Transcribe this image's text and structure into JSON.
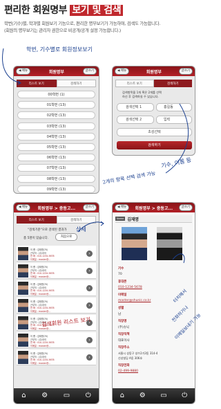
{
  "header": {
    "title_plain": "편리한 회원명부 ",
    "title_highlight": "보기 및 검색",
    "desc_line1": "학번(기수)별, 학과별 회원보기 기능으로, 편리한 명부보기가 가능하며, 검색도 가능합니다.",
    "desc_line2": "(회원의 명부보기는 관리자 권한으로 비공개/공개 설정 가능합니다.)"
  },
  "notes": {
    "n1": "학번, 기수별로 회원정보보기",
    "n2a": "기수, 이름 등",
    "n2b": "2개의 항목 선택 검색 가능",
    "n3": "상세",
    "n4": "검색회원 리스트 보기",
    "n5a": "전화하거나",
    "n5b": "이메일보내기 가능",
    "n5c": "터치해서"
  },
  "phone1": {
    "back": "◀ 메뉴",
    "title": "회원명부",
    "write": "글쓰기",
    "tab_list": "리스트 보기",
    "tab_search": "검색하기",
    "rows": [
      "00학번 (1)",
      "01학번 (13)",
      "02학번 (13)",
      "03학번 (13)",
      "04학번 (13)",
      "05학번 (13)",
      "06학번 (13)",
      "07학번 (13)",
      "08학번 (13)",
      "09학번 (13)"
    ]
  },
  "phone2": {
    "back": "◀ 메뉴",
    "title": "회원명부",
    "write": "글쓰기",
    "tab_list": "리스트 보기",
    "tab_search": "검색하기",
    "info1": "검색항목을 1개 혹은 2개를 선택",
    "info2": "하신 후 검색하실 수 있습니다.",
    "sel1": "검색선택 1",
    "sel1_val": "홍길동",
    "sel2": "검색선택 2",
    "sel2_val": "입력",
    "sel3": "초성선택",
    "search_btn": "검색하기"
  },
  "phone3": {
    "back": "◀ 메뉴",
    "title": "회원명부 > 중동고...",
    "write": "글쓰기",
    "tab_list": "리스트 보기",
    "tab_search": "검색하기",
    "result_text": "\"검색기준\"으로 검색된 결과가",
    "count_text": "총 5명이 있습니다.",
    "first_btn": "처음으로",
    "persons": [
      {
        "name": "이   름 : 김재명(70)",
        "job": "근무처 : (주)아이",
        "tel": "전   화 : 010-1234-5678",
        "mail": "이메일 : master@..."
      },
      {
        "name": "이   름 : 김재명(70)",
        "job": "근무처 : (주)아이",
        "tel": "전   화 : 010-1234-5678",
        "mail": "이메일 : master@..."
      },
      {
        "name": "이   름 : 김재명(70)",
        "job": "근무처 : (주)아이",
        "tel": "전   화 : 010-1234-5678",
        "mail": "이메일 : master@..."
      },
      {
        "name": "이   름 : 김재명(70)",
        "job": "근무처 : (주)아이",
        "tel": "전   화 : 010-1234-5678",
        "mail": "이메일 : master@..."
      },
      {
        "name": "이   름 : 김재명(70)",
        "job": "근무처 : (주)아이",
        "tel": "전   화 : 010-1234-5678",
        "mail": "이메일 : master@..."
      },
      {
        "name": "이   름 : 김재명(70)",
        "job": "근무처 : (주)아이",
        "tel": "전   화 : 010-1234-5678",
        "mail": "이메일 : master@..."
      },
      {
        "name": "이   름 : 김재명(70)",
        "job": "근무처 : (주)아이",
        "tel": "전   화 : 010-1234-5678",
        "mail": "이메일 : master@..."
      }
    ]
  },
  "phone4": {
    "back": "◀ 메뉴",
    "title": "회원명부 > 중동고...",
    "write": "글쓰기",
    "badge": "Name",
    "name": "김재명",
    "k1": "기수",
    "v1": "70",
    "k2": "휴대폰",
    "v2": "010-1234-5678",
    "k3": "이메일",
    "v3": "master@shunic.co.kr",
    "k4": "성별",
    "v4": "남",
    "k5": "직장명",
    "v5": "(주)슈닉",
    "k6": "직장직책",
    "v6": "대표이사",
    "k7": "직장주소",
    "v7": "서울시 성동구 성수2가3동 314-4",
    "v7b": "신성빌딩 A동 306호",
    "k8": "직장전화",
    "v8": "02-499-9880"
  },
  "colors": {
    "accent": "#b22026",
    "note": "#1a3f8f"
  },
  "bottom_icons": [
    "home-icon",
    "gear-icon",
    "monitor-icon",
    "power-icon"
  ]
}
